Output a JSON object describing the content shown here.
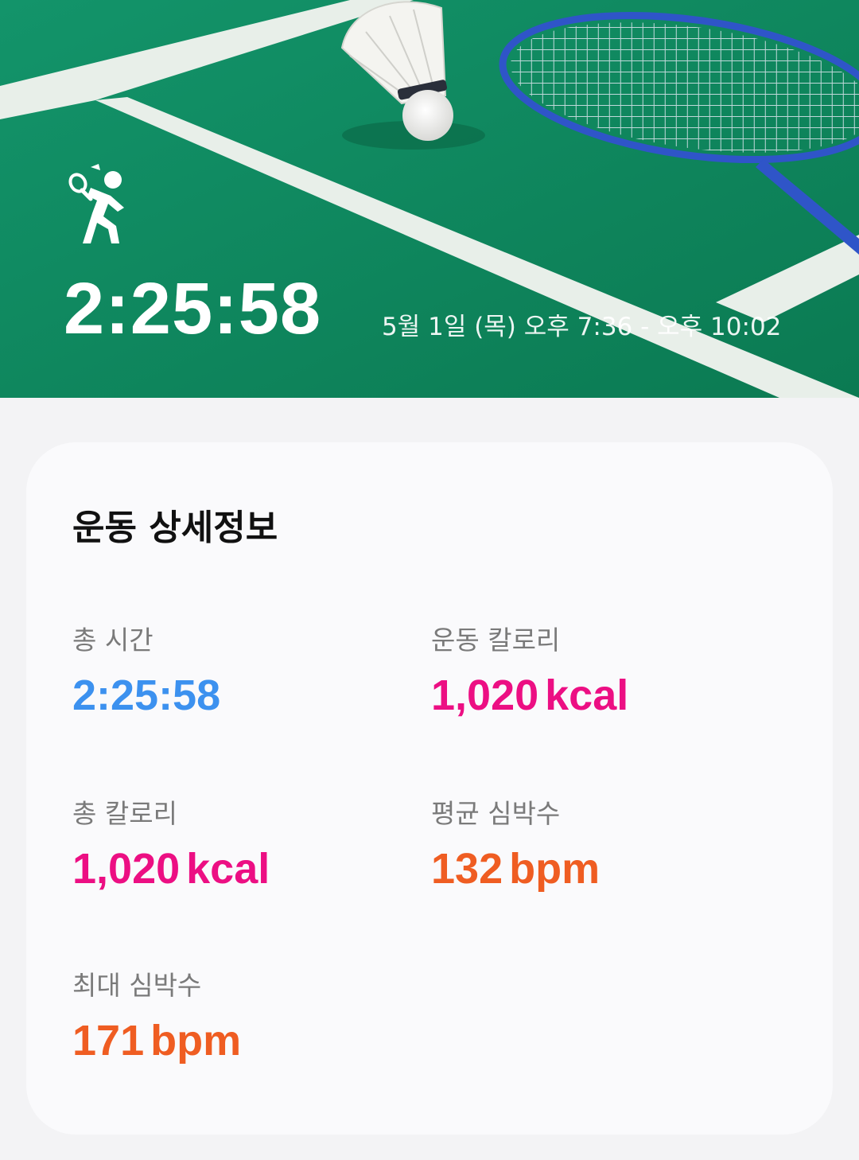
{
  "hero": {
    "sport_icon": "badminton-player-icon",
    "duration": "2:25:58",
    "date_range": "5월 1일 (목) 오후 7:36 - 오후 10:02"
  },
  "details": {
    "title": "운동 상세정보",
    "stats": [
      {
        "label": "총 시간",
        "value": "2:25:58",
        "unit": "",
        "color": "#3c91ef"
      },
      {
        "label": "운동 칼로리",
        "value": "1,020",
        "unit": "kcal",
        "color": "#ec0f83"
      },
      {
        "label": "총 칼로리",
        "value": "1,020",
        "unit": "kcal",
        "color": "#ec0f83"
      },
      {
        "label": "평균 심박수",
        "value": "132",
        "unit": "bpm",
        "color": "#ef5d22"
      },
      {
        "label": "최대 심박수",
        "value": "171",
        "unit": "bpm",
        "color": "#ef5d22"
      }
    ]
  },
  "colors": {
    "court_green": "#0f8a5e",
    "court_line": "#e8efe9",
    "racket_blue": "#2f55c8"
  }
}
